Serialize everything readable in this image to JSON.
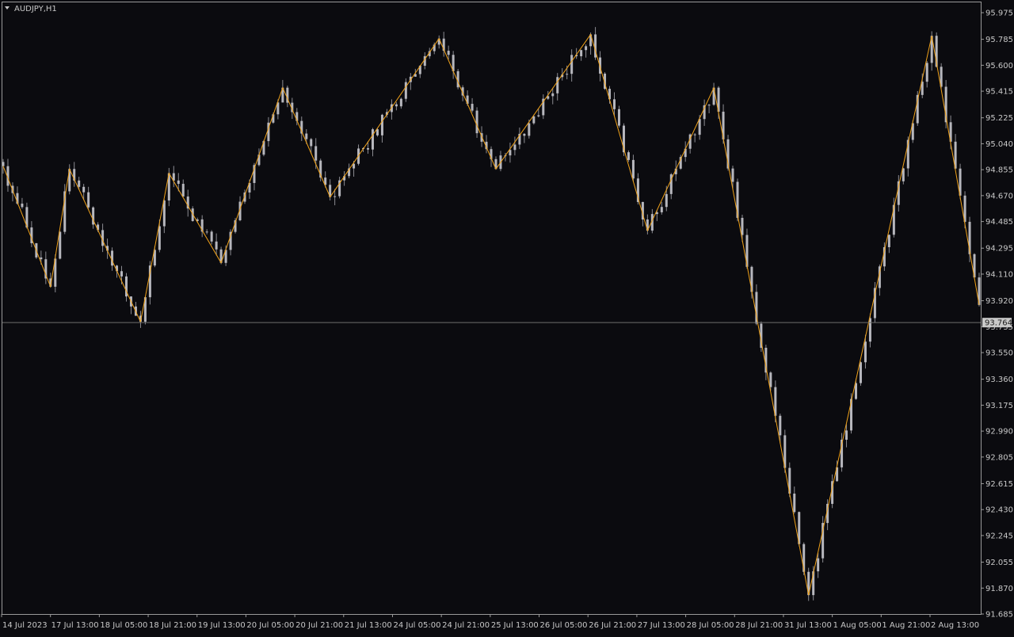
{
  "window": {
    "symbol_title": "AUDJPY,H1"
  },
  "colors": {
    "background": "#0b0b0f",
    "candle_body": "#b7b7bd",
    "candle_wick": "#8c8c92",
    "zigzag": "#f0a21a",
    "text": "#c8c8c8",
    "frame": "#9a9a9a",
    "price_line": "#6e6e6e",
    "price_tag_bg": "#c9c9c9",
    "price_tag_text": "#1a1a1a"
  },
  "chart_data": {
    "type": "candlestick",
    "title": "AUDJPY,H1",
    "price_axis": {
      "ylim": [
        91.685,
        95.975
      ],
      "ticks": [
        "95.975",
        "95.785",
        "95.600",
        "95.415",
        "95.225",
        "95.040",
        "94.855",
        "94.670",
        "94.485",
        "94.295",
        "94.110",
        "93.920",
        "93.735",
        "93.550",
        "93.360",
        "93.175",
        "92.990",
        "92.805",
        "92.615",
        "92.430",
        "92.245",
        "92.055",
        "91.870",
        "91.685"
      ]
    },
    "time_axis": {
      "labels": [
        "14 Jul 2023",
        "17 Jul 13:00",
        "18 Jul 05:00",
        "18 Jul 21:00",
        "19 Jul 13:00",
        "20 Jul 05:00",
        "20 Jul 21:00",
        "21 Jul 13:00",
        "24 Jul 05:00",
        "24 Jul 21:00",
        "25 Jul 13:00",
        "26 Jul 05:00",
        "26 Jul 21:00",
        "27 Jul 13:00",
        "28 Jul 05:00",
        "28 Jul 21:00",
        "31 Jul 13:00",
        "1 Aug 05:00",
        "1 Aug 21:00",
        "2 Aug 13:00"
      ]
    },
    "current_price": "93.764",
    "zigzag": {
      "name": "ZigZag",
      "bars": [
        0,
        10,
        14,
        29,
        35,
        46,
        59,
        69,
        92,
        104,
        124,
        136,
        150,
        170,
        196,
        206
      ],
      "prices": [
        94.88,
        94.02,
        94.86,
        93.77,
        94.83,
        94.19,
        95.44,
        94.66,
        95.79,
        94.86,
        95.82,
        94.42,
        95.44,
        91.82,
        95.81,
        93.89
      ]
    },
    "candles": {
      "count": 207,
      "seed": 1234,
      "noise": 0.055
    }
  }
}
